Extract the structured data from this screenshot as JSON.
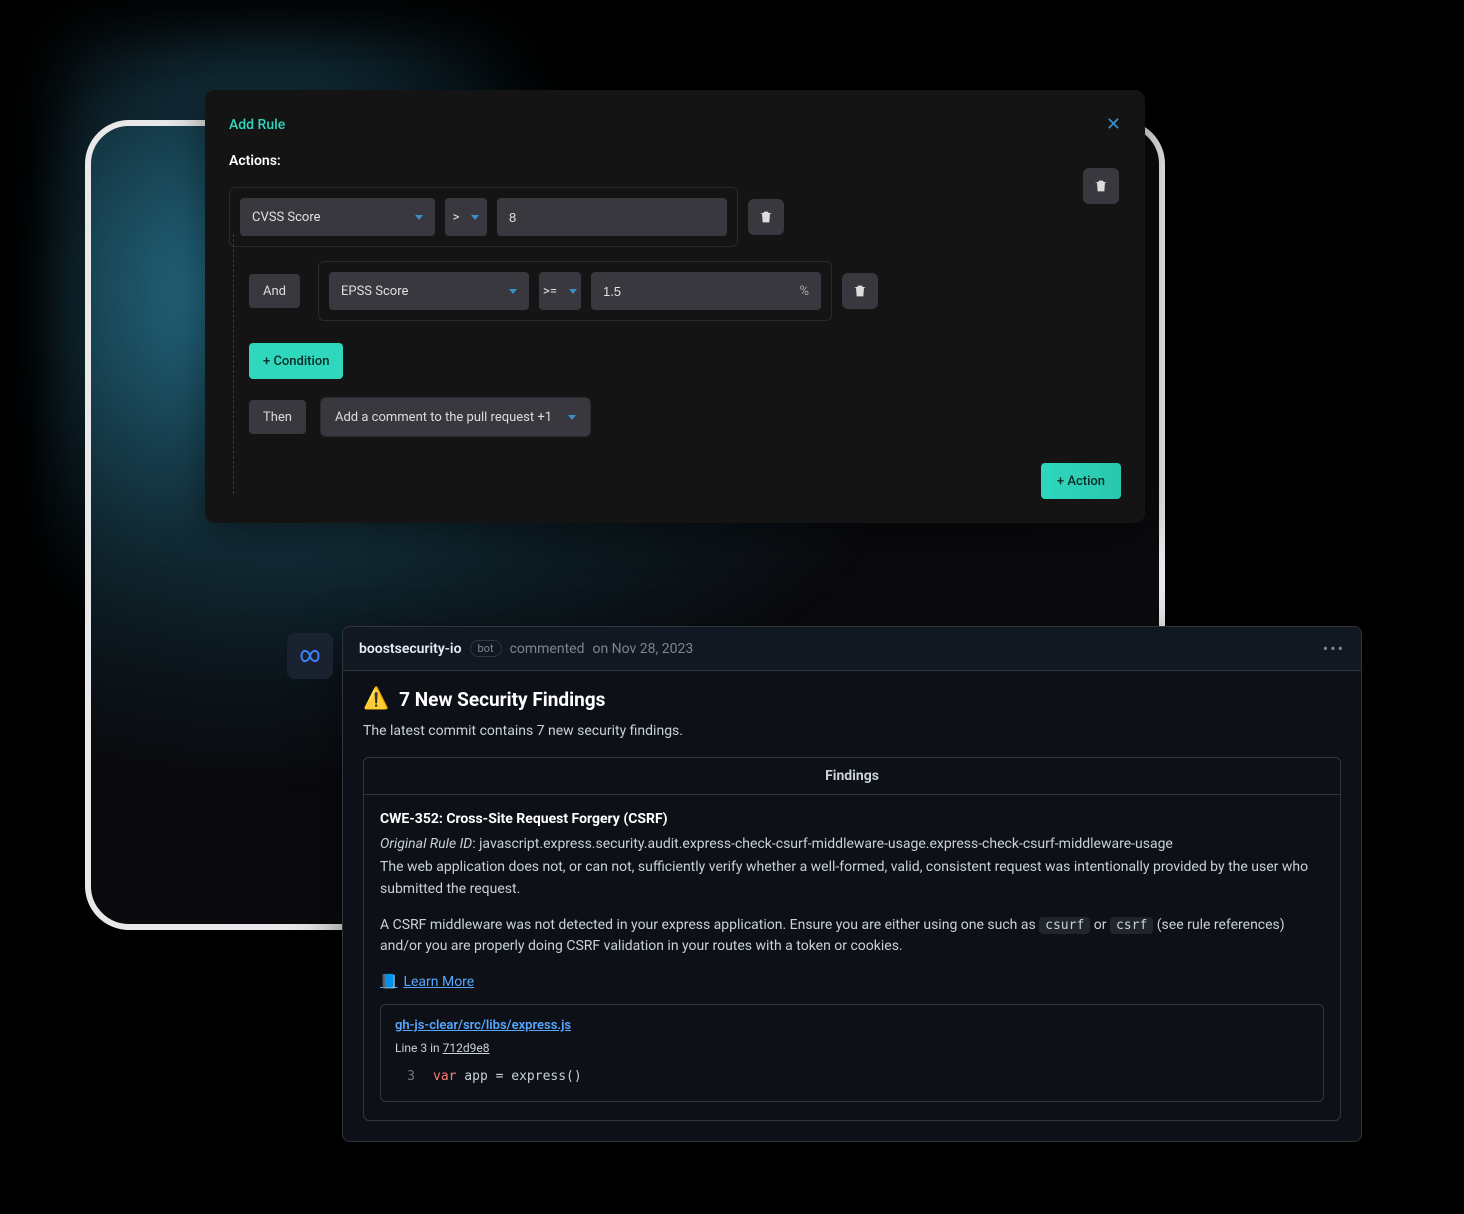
{
  "modal": {
    "title": "Add Rule",
    "actions_label": "Actions:",
    "rule1": {
      "field": "CVSS Score",
      "operator": ">",
      "value": "8"
    },
    "connector": "And",
    "rule2": {
      "field": "EPSS Score",
      "operator": ">=",
      "value": "1.5",
      "suffix": "%"
    },
    "add_condition": "+ Condition",
    "then_label": "Then",
    "then_action": "Add a comment to the pull request +1",
    "add_action": "+ Action"
  },
  "github": {
    "author": "boostsecurity-io",
    "bot_badge": "bot",
    "commented": "commented",
    "date": "on Nov 28, 2023",
    "heading": "7 New Security Findings",
    "subheading": "The latest commit contains 7 new security findings.",
    "table_header": "Findings",
    "cwe_title": "CWE-352: Cross-Site Request Forgery (CSRF)",
    "orig_rule_label": "Original Rule ID",
    "orig_rule_id": "javascript.express.security.audit.express-check-csurf-middleware-usage.express-check-csurf-middleware-usage",
    "desc1": "The web application does not, or can not, sufficiently verify whether a well-formed, valid, consistent request was intentionally provided by the user who submitted the request.",
    "desc2_pre": "A CSRF middleware was not detected in your express application. Ensure you are either using one such as ",
    "desc2_code1": "csurf",
    "desc2_mid": " or ",
    "desc2_code2": "csrf",
    "desc2_post": " (see rule references) and/or you are properly doing CSRF validation in your routes with a token or cookies.",
    "learn_more": "Learn More",
    "file_link": "gh-js-clear/src/libs/express.js",
    "line_label": "Line 3 in ",
    "commit": "712d9e8",
    "line_num": "3",
    "code_kw": "var",
    "code_rest": " app = express()"
  }
}
